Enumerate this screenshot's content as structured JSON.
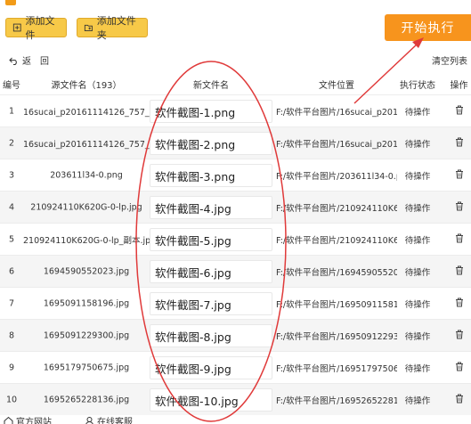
{
  "app": {
    "title": ""
  },
  "toolbar": {
    "add_file": "添加文件",
    "add_folder": "添加文件夹",
    "start": "开始执行"
  },
  "actions": {
    "back": "返",
    "redo": "回",
    "clear": "清空列表"
  },
  "table": {
    "headers": {
      "index": "编号",
      "source": "源文件名（193）",
      "newname": "新文件名",
      "location": "文件位置",
      "status": "执行状态",
      "op": "操作"
    },
    "rows": [
      {
        "index": "1",
        "source": "16sucai_p20161114126_757_副...",
        "newname": "软件截图-1.png",
        "location": "F:/软件平台图片/16sucai_p201...",
        "status": "待操作"
      },
      {
        "index": "2",
        "source": "16sucai_p20161114126_757_副...",
        "newname": "软件截图-2.png",
        "location": "F:/软件平台图片/16sucai_p201...",
        "status": "待操作"
      },
      {
        "index": "3",
        "source": "203611l34-0.png",
        "newname": "软件截图-3.png",
        "location": "F:/软件平台图片/203611l34-0.p...",
        "status": "待操作"
      },
      {
        "index": "4",
        "source": "210924110K620G-0-lp.jpg",
        "newname": "软件截图-4.jpg",
        "location": "F:/软件平台图片/210924110K62...",
        "status": "待操作"
      },
      {
        "index": "5",
        "source": "210924110K620G-0-lp_副本.jpg",
        "newname": "软件截图-5.jpg",
        "location": "F:/软件平台图片/210924110K62...",
        "status": "待操作"
      },
      {
        "index": "6",
        "source": "1694590552023.jpg",
        "newname": "软件截图-6.jpg",
        "location": "F:/软件平台图片/169459055202...",
        "status": "待操作"
      },
      {
        "index": "7",
        "source": "1695091158196.jpg",
        "newname": "软件截图-7.jpg",
        "location": "F:/软件平台图片/169509115819...",
        "status": "待操作"
      },
      {
        "index": "8",
        "source": "1695091229300.jpg",
        "newname": "软件截图-8.jpg",
        "location": "F:/软件平台图片/169509122930...",
        "status": "待操作"
      },
      {
        "index": "9",
        "source": "1695179750675.jpg",
        "newname": "软件截图-9.jpg",
        "location": "F:/软件平台图片/169517975067...",
        "status": "待操作"
      },
      {
        "index": "10",
        "source": "1695265228136.jpg",
        "newname": "软件截图-10.jpg",
        "location": "F:/软件平台图片/169526522813...",
        "status": "待操作"
      }
    ]
  },
  "footer": {
    "website": "官方网站",
    "support": "在线客服"
  },
  "colors": {
    "accent": "#f7941d",
    "button": "#f7c948",
    "annotation": "#e03a3a"
  }
}
